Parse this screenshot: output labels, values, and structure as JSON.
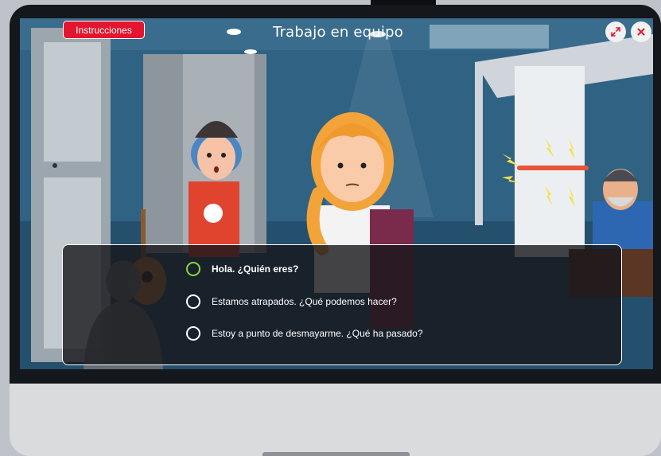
{
  "header": {
    "instructions_label": "Instrucciones",
    "title": "Trabajo en equipo",
    "fullscreen_icon": "expand-arrows-icon",
    "close_icon": "close-x-icon"
  },
  "dialog": {
    "options": [
      {
        "label": "Hola. ¿Quién eres?",
        "selected": true
      },
      {
        "label": "Estamos atrapados. ¿Qué podemos hacer?",
        "selected": false
      },
      {
        "label": "Estoy a punto de desmayarme. ¿Qué ha pasado?",
        "selected": false
      }
    ]
  },
  "colors": {
    "instructions_button": "#e4162f",
    "selected_radio": "#8ed33a",
    "dialog_background": "rgba(22,22,26,0.8)"
  }
}
